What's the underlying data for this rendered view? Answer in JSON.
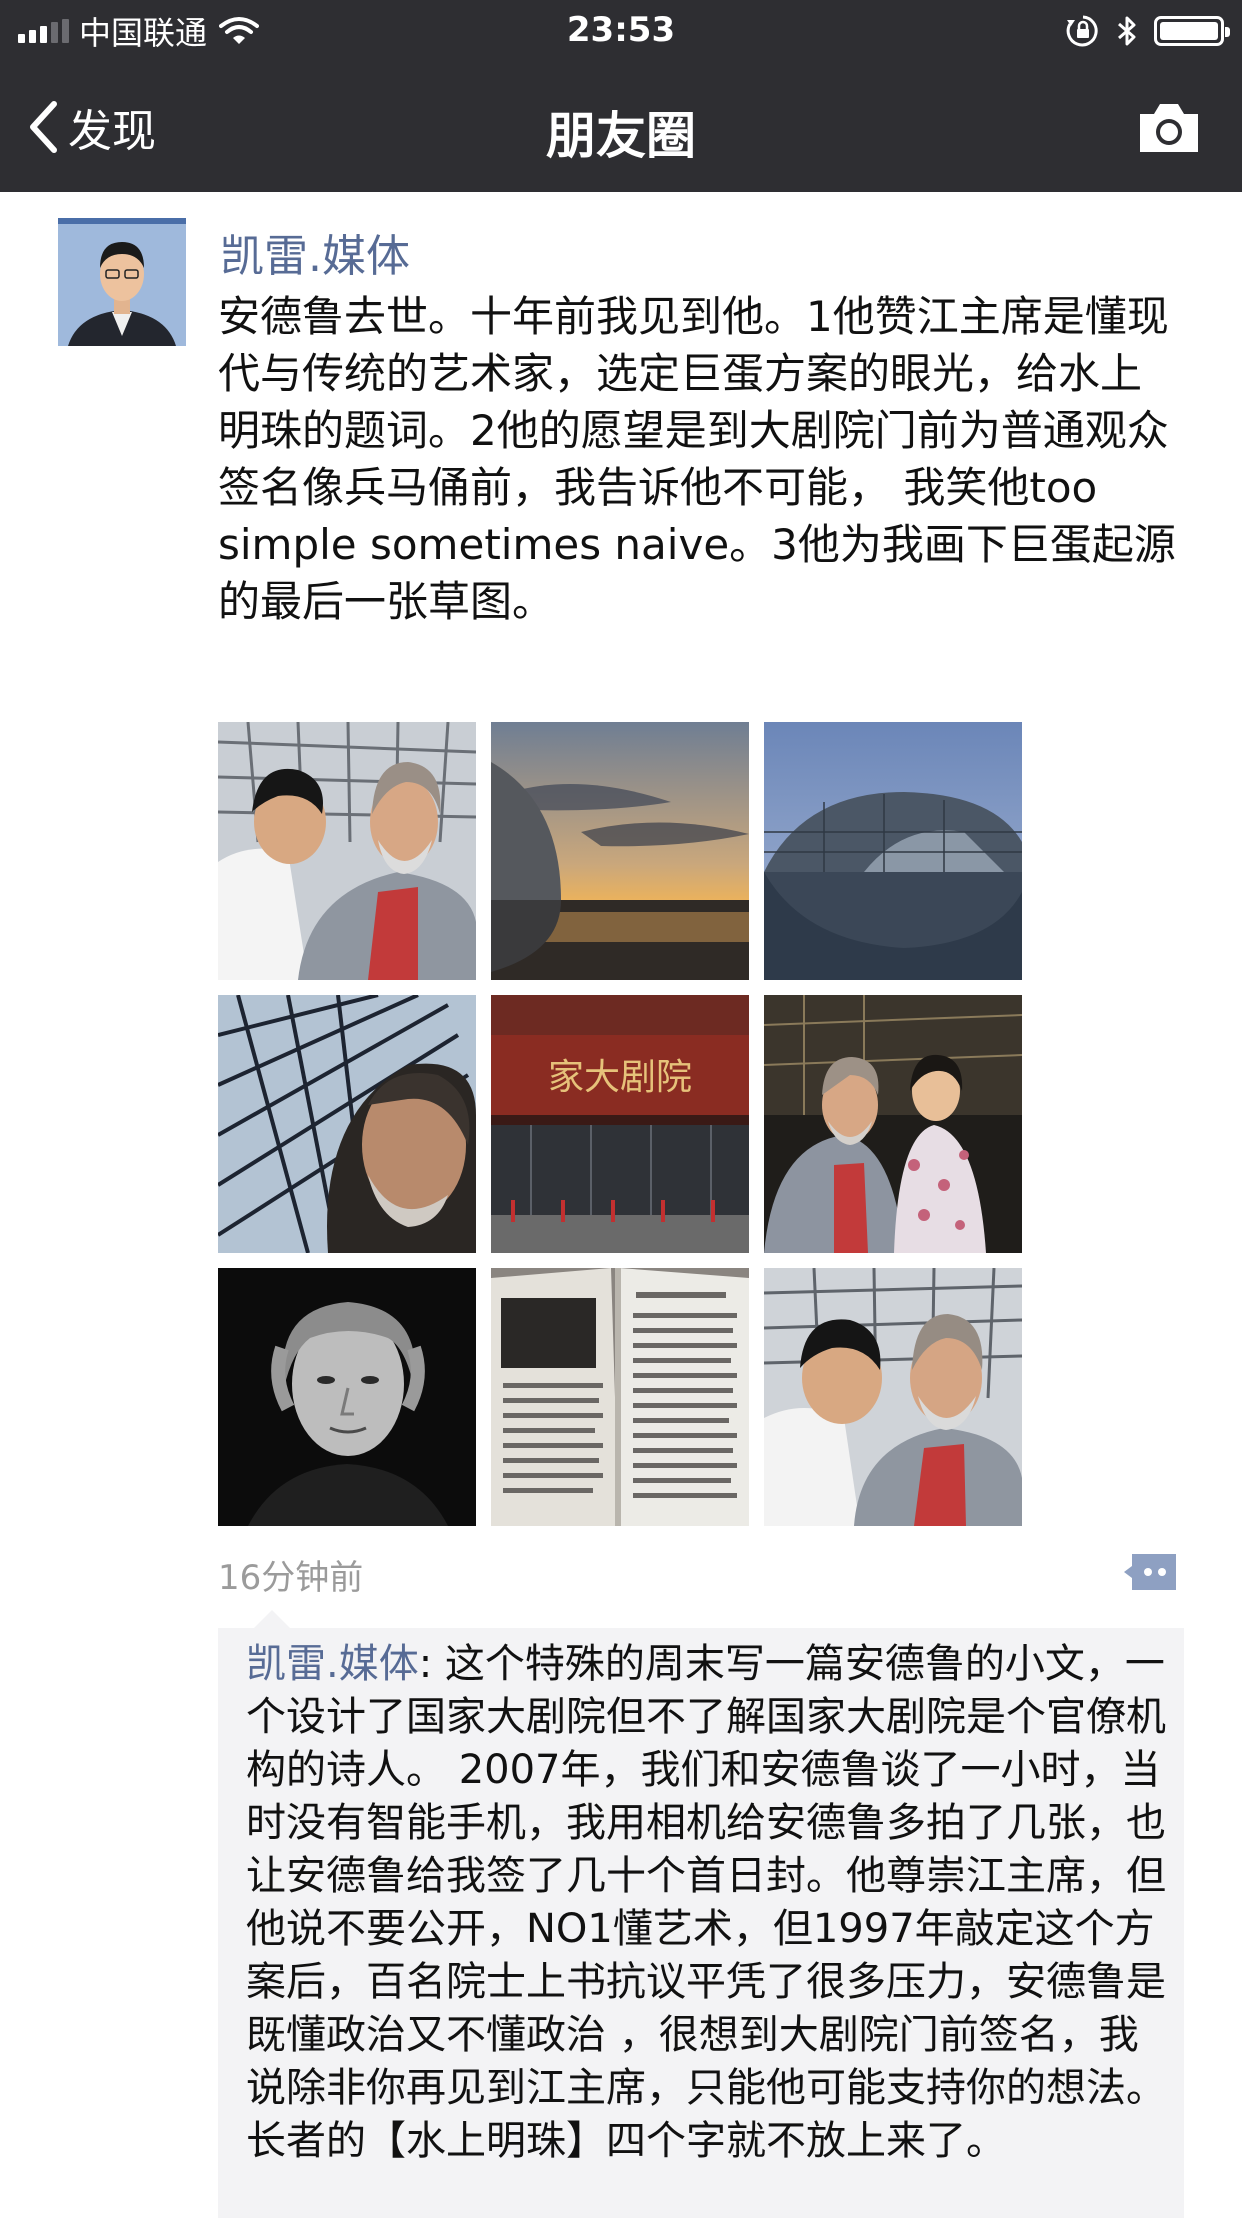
{
  "status_bar": {
    "carrier": "中国联通",
    "time": "23:53",
    "icons": [
      "signal-icon",
      "wifi-icon",
      "rotation-lock-icon",
      "bluetooth-icon",
      "battery-icon"
    ]
  },
  "nav": {
    "back_label": "发现",
    "title": "朋友圈",
    "camera_icon": "camera-icon"
  },
  "post": {
    "author": "凯雷.媒体",
    "text": "安德鲁去世。十年前我见到他。1他赞江主席是懂现代与传统的艺术家，选定巨蛋方案的眼光，给水上明珠的题词。2他的愿望是到大剧院门前为普通观众签名像兵马俑前，我告诉他不可能， 我笑他too simple sometimes naive。3他为我画下巨蛋起源的最后一张草图。",
    "photo_signs": {
      "theater_sign": "家大剧院"
    },
    "time_ago": "16分钟前"
  },
  "comments": [
    {
      "author": "凯雷.媒体",
      "separator": ": ",
      "text": "这个特殊的周末写一篇安德鲁的小文，一个设计了国家大剧院但不了解国家大剧院是个官僚机构的诗人。 2007年，我们和安德鲁谈了一小时，当时没有智能手机，我用相机给安德鲁多拍了几张，也让安德鲁给我签了几十个首日封。他尊崇江主席，但他说不要公开，NO1懂艺术，但1997年敲定这个方案后，百名院士上书抗议平凭了很多压力，安德鲁是既懂政治又不懂政治 ，很想到大剧院门前签名，我说除非你再见到江主席，只能他可能支持你的想法。长者的【水上明珠】四个字就不放上来了。"
    }
  ],
  "colors": {
    "bar_background": "#2e2e32",
    "link_blue": "#576b95",
    "timestamp_gray": "#9b9b9b",
    "comment_background": "#f3f3f5"
  }
}
